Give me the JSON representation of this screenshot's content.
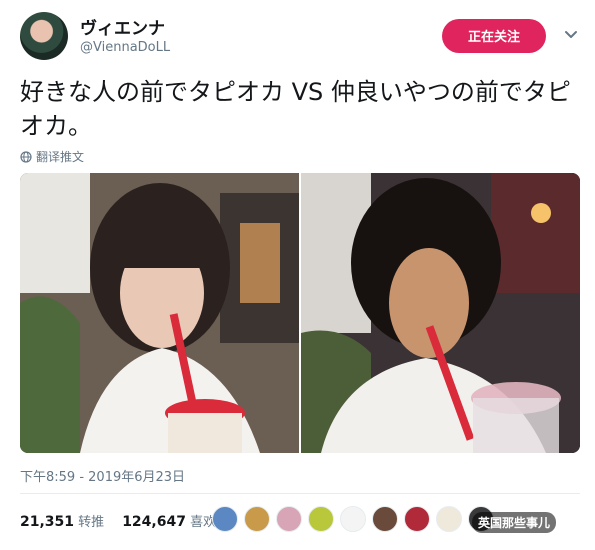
{
  "user": {
    "display_name": "ヴィエンナ",
    "handle": "@ViennaDoLL"
  },
  "follow_button": {
    "label": "正在关注"
  },
  "tweet": {
    "text": "好きな人の前でタピオカ VS 仲良いやつの前でタピオカ。",
    "translate_label": "翻译推文"
  },
  "photos": [
    {
      "alt": ""
    },
    {
      "alt": ""
    }
  ],
  "timestamp": "下午8:59 - 2019年6月23日",
  "stats": {
    "retweets_count": "21,351",
    "retweets_label": "转推",
    "likes_count": "124,647",
    "likes_label": "喜欢"
  },
  "watermark": "英国那些事儿",
  "colors": {
    "accent": "#e0245e",
    "secondary_text": "#657786"
  }
}
